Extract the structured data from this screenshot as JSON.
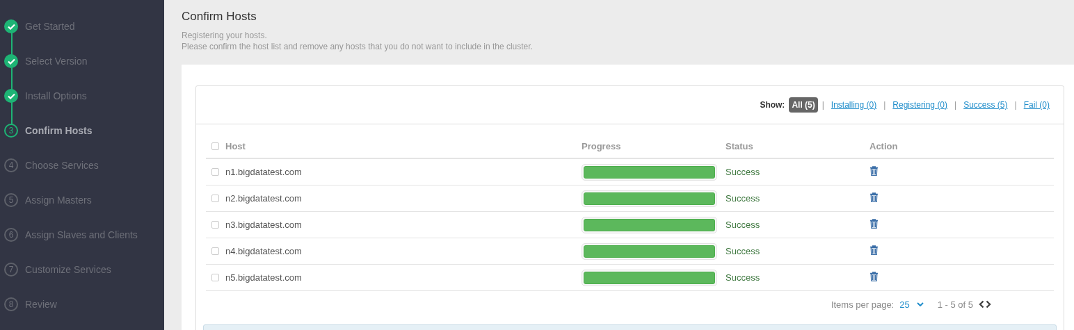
{
  "steps": [
    {
      "label": "Get Started",
      "completed": true,
      "selected": false
    },
    {
      "label": "Select Version",
      "completed": true,
      "selected": false
    },
    {
      "label": "Install Options",
      "completed": true,
      "selected": false
    },
    {
      "number": "3",
      "label": "Confirm Hosts",
      "completed": false,
      "selected": true
    },
    {
      "number": "4",
      "label": "Choose Services",
      "completed": false,
      "selected": false
    },
    {
      "number": "5",
      "label": "Assign Masters",
      "completed": false,
      "selected": false
    },
    {
      "number": "6",
      "label": "Assign Slaves and Clients",
      "completed": false,
      "selected": false
    },
    {
      "number": "7",
      "label": "Customize Services",
      "completed": false,
      "selected": false
    },
    {
      "number": "8",
      "label": "Review",
      "completed": false,
      "selected": false
    }
  ],
  "page": {
    "title": "Confirm Hosts",
    "description_lines": [
      "Registering your hosts.",
      "Please confirm the host list and remove any hosts that you do not want to include in the cluster."
    ]
  },
  "filter": {
    "label": "Show:",
    "separator": "|",
    "options": [
      {
        "label": "All (5)",
        "selected": true
      },
      {
        "label": "Installing (0)",
        "selected": false
      },
      {
        "label": "Registering (0)",
        "selected": false
      },
      {
        "label": "Success (5)",
        "selected": false
      },
      {
        "label": "Fail (0)",
        "selected": false
      }
    ]
  },
  "table": {
    "select_all_checked": false,
    "columns": [
      "Host",
      "Progress",
      "Status",
      "Action"
    ],
    "rows": [
      {
        "host": "n1.bigdatatest.com",
        "checked": false,
        "level": 1,
        "status": "Success"
      },
      {
        "host": "n2.bigdatatest.com",
        "checked": false,
        "level": 1,
        "status": "Success"
      },
      {
        "host": "n3.bigdatatest.com",
        "checked": false,
        "level": 1,
        "status": "Success"
      },
      {
        "host": "n4.bigdatatest.com",
        "checked": false,
        "level": 1,
        "status": "Success"
      },
      {
        "host": "n5.bigdatatest.com",
        "checked": false,
        "level": 1,
        "status": "Success"
      }
    ]
  },
  "pagination": {
    "items_label": "Items per page:",
    "per_page": "25",
    "range": "1 - 5 of 5"
  }
}
